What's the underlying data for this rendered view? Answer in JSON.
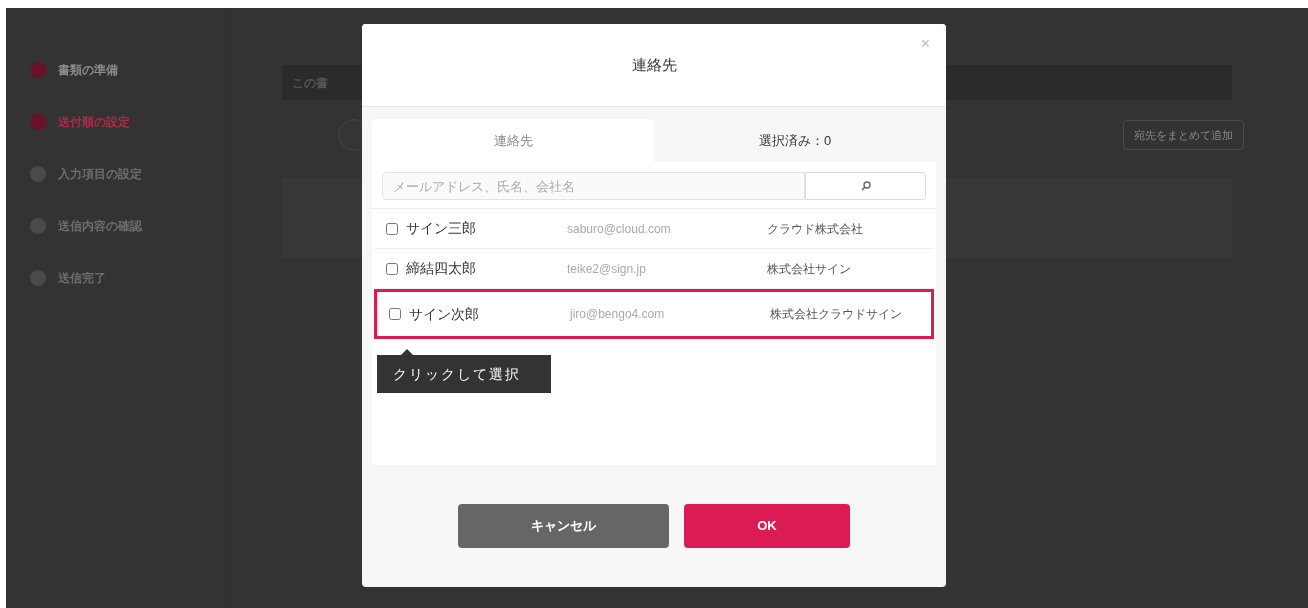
{
  "steps": [
    {
      "label": "書類の準備",
      "completed": true,
      "selected": false
    },
    {
      "label": "送付順の設定",
      "completed": true,
      "selected": true
    },
    {
      "label": "入力項目の設定",
      "completed": false,
      "selected": false
    },
    {
      "label": "送信内容の確認",
      "completed": false,
      "selected": false
    },
    {
      "label": "送信完了",
      "completed": false,
      "selected": false
    }
  ],
  "background": {
    "hint": "この書",
    "bulk_add_button": "宛先をまとめて追加"
  },
  "dialog": {
    "title": "連絡先",
    "close": "×",
    "tabs": [
      {
        "label": "連絡先",
        "selected": true
      },
      {
        "label": "選択済み：0",
        "selected": false
      }
    ],
    "search": {
      "placeholder": "メールアドレス、氏名、会社名"
    },
    "contacts": [
      {
        "name": "サイン三郎",
        "email": "saburo@cloud.com",
        "company": "クラウド株式会社",
        "checked": false,
        "highlighted": false
      },
      {
        "name": "締結四太郎",
        "email": "teike2@sign.jp",
        "company": "株式会社サイン",
        "checked": false,
        "highlighted": false
      },
      {
        "name": "サイン次郎",
        "email": "jiro@bengo4.com",
        "company": "株式会社クラウドサイン",
        "checked": false,
        "highlighted": true
      }
    ],
    "tooltip": "クリックして選択",
    "buttons": [
      {
        "label": "キャンセル",
        "kind": "cancel"
      },
      {
        "label": "OK",
        "kind": "primary"
      }
    ]
  }
}
